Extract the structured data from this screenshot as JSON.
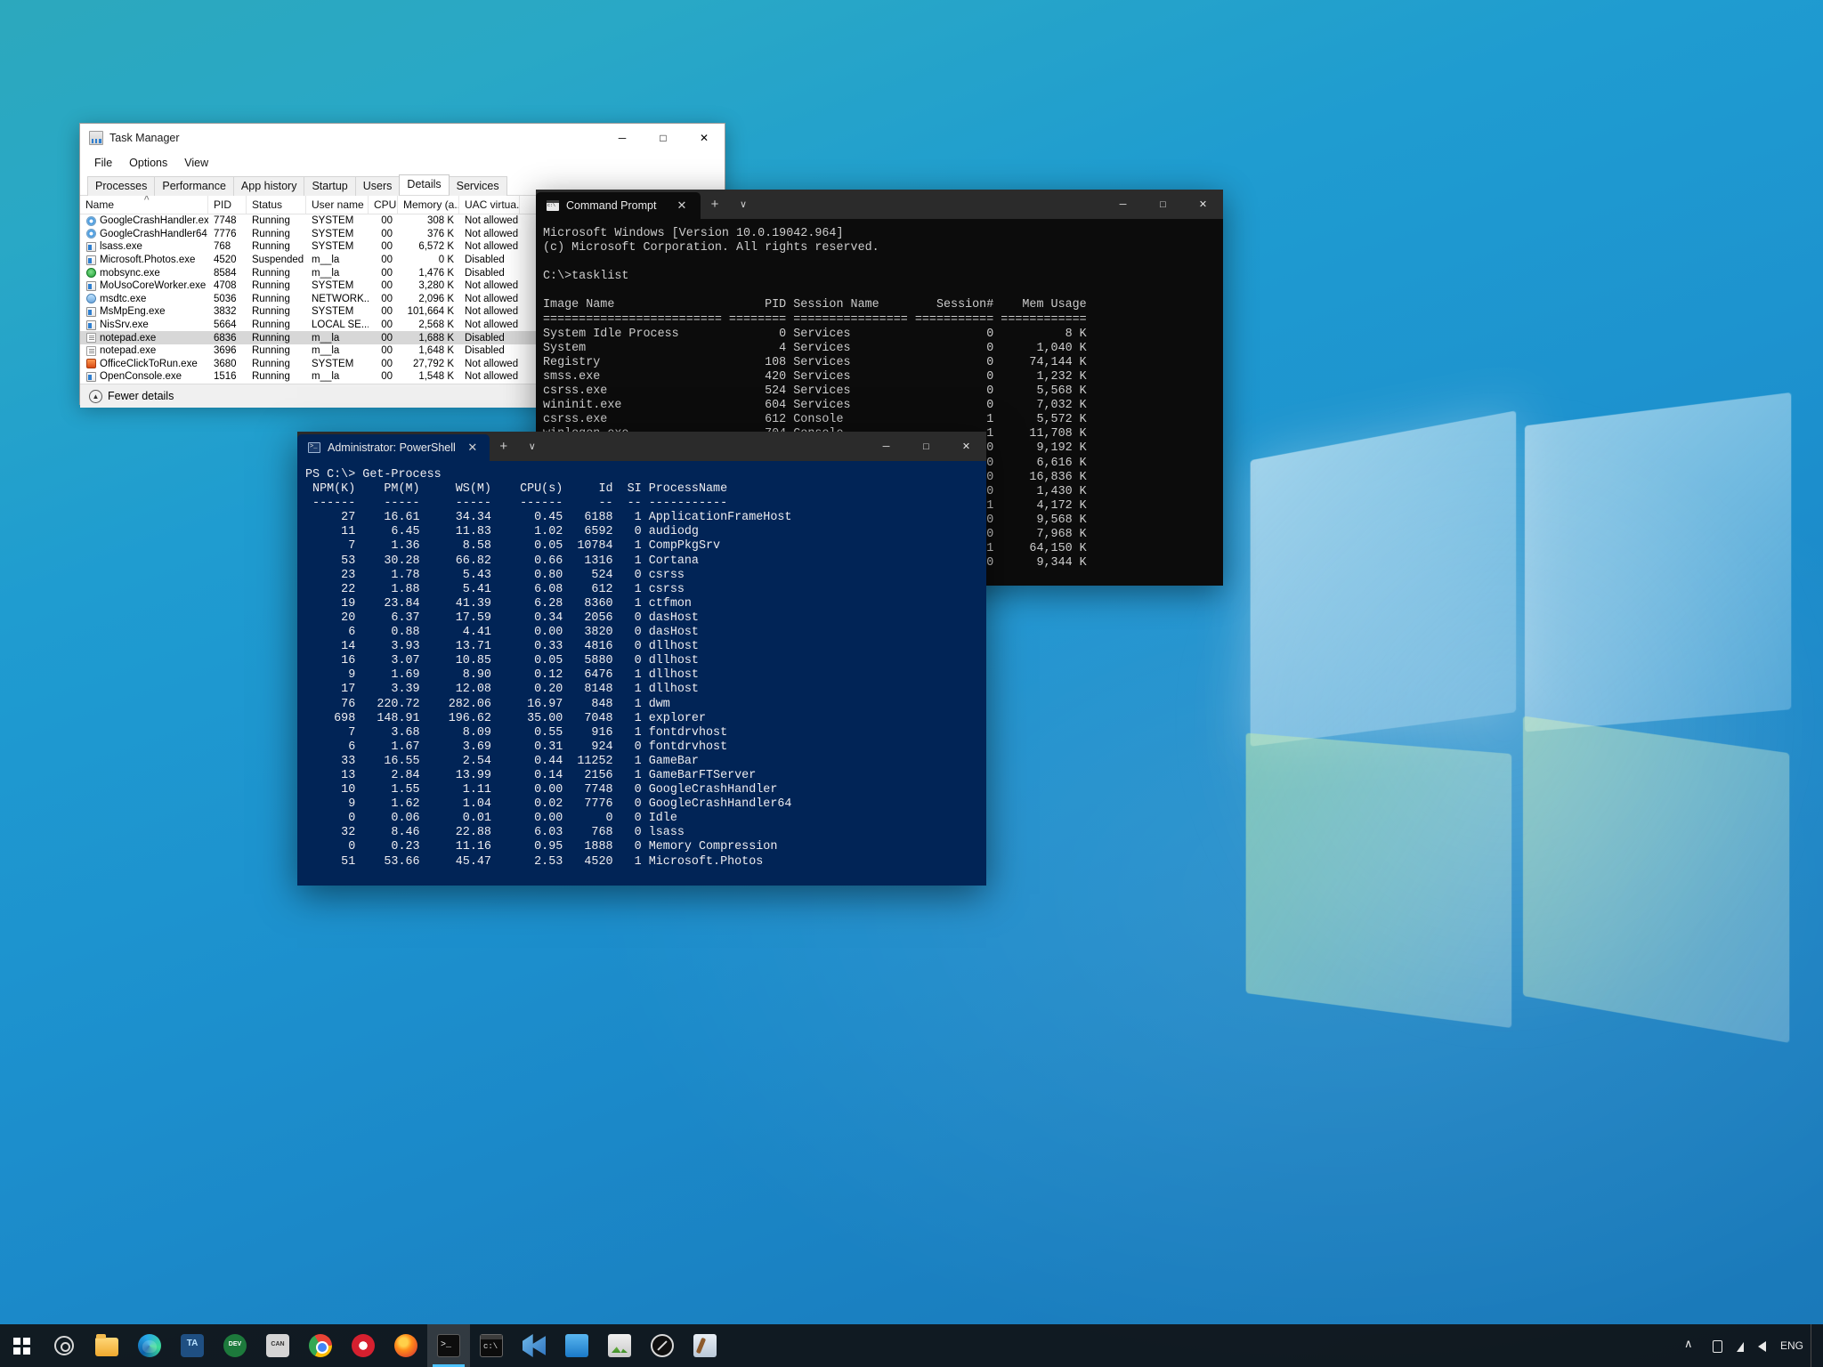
{
  "taskmanager": {
    "title": "Task Manager",
    "icon": "task-manager-icon",
    "window_buttons": {
      "minimize": "─",
      "maximize": "□",
      "close": "✕"
    },
    "menus": [
      "File",
      "Options",
      "View"
    ],
    "tabs": [
      {
        "label": "Processes",
        "active": false
      },
      {
        "label": "Performance",
        "active": false
      },
      {
        "label": "App history",
        "active": false
      },
      {
        "label": "Startup",
        "active": false
      },
      {
        "label": "Users",
        "active": false
      },
      {
        "label": "Details",
        "active": true
      },
      {
        "label": "Services",
        "active": false
      }
    ],
    "columns": [
      "Name",
      "PID",
      "Status",
      "User name",
      "CPU",
      "Memory (a...",
      "UAC virtua..."
    ],
    "sort_column": "Name",
    "rows": [
      {
        "name": "GoogleCrashHandler.exe",
        "icon": "chrome-icon",
        "pid": "7748",
        "status": "Running",
        "user": "SYSTEM",
        "cpu": "00",
        "memory": "308 K",
        "uac": "Not allowed",
        "selected": false
      },
      {
        "name": "GoogleCrashHandler64.exe",
        "icon": "chrome-icon",
        "pid": "7776",
        "status": "Running",
        "user": "SYSTEM",
        "cpu": "00",
        "memory": "376 K",
        "uac": "Not allowed",
        "selected": false
      },
      {
        "name": "lsass.exe",
        "icon": "document-icon",
        "pid": "768",
        "status": "Running",
        "user": "SYSTEM",
        "cpu": "00",
        "memory": "6,572 K",
        "uac": "Not allowed",
        "selected": false
      },
      {
        "name": "Microsoft.Photos.exe",
        "icon": "document-icon",
        "pid": "4520",
        "status": "Suspended",
        "user": "m__la",
        "cpu": "00",
        "memory": "0 K",
        "uac": "Disabled",
        "selected": false
      },
      {
        "name": "mobsync.exe",
        "icon": "green-circle-icon",
        "pid": "8584",
        "status": "Running",
        "user": "m__la",
        "cpu": "00",
        "memory": "1,476 K",
        "uac": "Disabled",
        "selected": false
      },
      {
        "name": "MoUsoCoreWorker.exe",
        "icon": "document-icon",
        "pid": "4708",
        "status": "Running",
        "user": "SYSTEM",
        "cpu": "00",
        "memory": "3,280 K",
        "uac": "Not allowed",
        "selected": false
      },
      {
        "name": "msdtc.exe",
        "icon": "blue-circle-icon",
        "pid": "5036",
        "status": "Running",
        "user": "NETWORK...",
        "cpu": "00",
        "memory": "2,096 K",
        "uac": "Not allowed",
        "selected": false
      },
      {
        "name": "MsMpEng.exe",
        "icon": "document-icon",
        "pid": "3832",
        "status": "Running",
        "user": "SYSTEM",
        "cpu": "00",
        "memory": "101,664 K",
        "uac": "Not allowed",
        "selected": false
      },
      {
        "name": "NisSrv.exe",
        "icon": "document-icon",
        "pid": "5664",
        "status": "Running",
        "user": "LOCAL SE...",
        "cpu": "00",
        "memory": "2,568 K",
        "uac": "Not allowed",
        "selected": false
      },
      {
        "name": "notepad.exe",
        "icon": "notepad-icon",
        "pid": "6836",
        "status": "Running",
        "user": "m__la",
        "cpu": "00",
        "memory": "1,688 K",
        "uac": "Disabled",
        "selected": true
      },
      {
        "name": "notepad.exe",
        "icon": "notepad-icon",
        "pid": "3696",
        "status": "Running",
        "user": "m__la",
        "cpu": "00",
        "memory": "1,648 K",
        "uac": "Disabled",
        "selected": false
      },
      {
        "name": "OfficeClickToRun.exe",
        "icon": "orange-icon",
        "pid": "3680",
        "status": "Running",
        "user": "SYSTEM",
        "cpu": "00",
        "memory": "27,792 K",
        "uac": "Not allowed",
        "selected": false
      },
      {
        "name": "OpenConsole.exe",
        "icon": "document-icon",
        "pid": "1516",
        "status": "Running",
        "user": "m__la",
        "cpu": "00",
        "memory": "1,548 K",
        "uac": "Not allowed",
        "selected": false
      }
    ],
    "footer": {
      "label": "Fewer details",
      "icon": "chevron-up-circle-icon"
    }
  },
  "cmd": {
    "tab_title": "Command Prompt",
    "tab_icon": "cmd-icon",
    "close_tab": "✕",
    "new_tab": "+",
    "tab_menu": "∨",
    "window_buttons": {
      "minimize": "─",
      "maximize": "□",
      "close": "✕"
    },
    "content": "Microsoft Windows [Version 10.0.19042.964]\n(c) Microsoft Corporation. All rights reserved.\n\nC:\\>tasklist\n\nImage Name                     PID Session Name        Session#    Mem Usage\n========================= ======== ================ =========== ============\nSystem Idle Process              0 Services                   0          8 K\nSystem                           4 Services                   0      1,040 K\nRegistry                       108 Services                   0     74,144 K\nsmss.exe                       420 Services                   0      1,232 K\ncsrss.exe                      524 Services                   0      5,568 K\nwininit.exe                    604 Services                   0      7,032 K\ncsrss.exe                      612 Console                    1      5,572 K\nwinlogon.exe                   704 Console                    1     11,708 K\nservices.exe                   752 Services                   0      9,192 K\nlsass.exe                      768 Services                   0      6,616 K\nsvchost.exe                    908 Services                   0     16,836 K\nfontdrvhost.exe                924 Services                   0      1,430 K\nfontdrvhost.exe                916 Console                    1      4,172 K\nsvchost.exe                    468 Services                   0      9,568 K\nsvchost.exe                   1052 Services                   0      7,968 K\ndwm.exe                        848 Console                    1     64,150 K\nsvchost.exe                   1180 Services                   0      9,344 K"
  },
  "powershell": {
    "tab_title": "Administrator: PowerShell",
    "tab_icon": "powershell-icon",
    "close_tab": "✕",
    "new_tab": "+",
    "tab_menu": "∨",
    "window_buttons": {
      "minimize": "─",
      "maximize": "□",
      "close": "✕"
    },
    "prompt": "PS C:\\> Get-Process",
    "header": " NPM(K)    PM(M)     WS(M)    CPU(s)     Id  SI ProcessName",
    "separator": " ------    -----     -----    ------     --  -- -----------",
    "content": "     27    16.61     34.34      0.45   6188   1 ApplicationFrameHost\n     11     6.45     11.83      1.02   6592   0 audiodg\n      7     1.36      8.58      0.05  10784   1 CompPkgSrv\n     53    30.28     66.82      0.66   1316   1 Cortana\n     23     1.78      5.43      0.80    524   0 csrss\n     22     1.88      5.41      6.08    612   1 csrss\n     19    23.84     41.39      6.28   8360   1 ctfmon\n     20     6.37     17.59      0.34   2056   0 dasHost\n      6     0.88      4.41      0.00   3820   0 dasHost\n     14     3.93     13.71      0.33   4816   0 dllhost\n     16     3.07     10.85      0.05   5880   0 dllhost\n      9     1.69      8.90      0.12   6476   1 dllhost\n     17     3.39     12.08      0.20   8148   1 dllhost\n     76   220.72    282.06     16.97    848   1 dwm\n    698   148.91    196.62     35.00   7048   1 explorer\n      7     3.68      8.09      0.55    916   1 fontdrvhost\n      6     1.67      3.69      0.31    924   0 fontdrvhost\n     33    16.55      2.54      0.44  11252   1 GameBar\n     13     2.84     13.99      0.14   2156   1 GameBarFTServer\n     10     1.55      1.11      0.00   7748   0 GoogleCrashHandler\n      9     1.62      1.04      0.02   7776   0 GoogleCrashHandler64\n      0     0.06      0.01      0.00      0   0 Idle\n     32     8.46     22.88      6.03    768   0 lsass\n      0     0.23     11.16      0.95   1888   0 Memory Compression\n     51    53.66     45.47      2.53   4520   1 Microsoft.Photos"
  },
  "taskbar": {
    "start": {
      "name": "start-button"
    },
    "items": [
      {
        "name": "settings",
        "icon": "settings-gear-icon",
        "active": false
      },
      {
        "name": "file-explorer",
        "icon": "folder-icon",
        "active": false
      },
      {
        "name": "microsoft-edge",
        "icon": "edge-icon",
        "active": false
      },
      {
        "name": "ta-app",
        "icon": "ta-icon",
        "active": false
      },
      {
        "name": "dev-app",
        "icon": "dev-icon",
        "active": false
      },
      {
        "name": "can-app",
        "icon": "can-icon",
        "active": false
      },
      {
        "name": "google-chrome",
        "icon": "chrome-icon",
        "active": false
      },
      {
        "name": "opera",
        "icon": "opera-icon",
        "active": false
      },
      {
        "name": "firefox",
        "icon": "firefox-icon",
        "active": false
      },
      {
        "name": "windows-terminal",
        "icon": "terminal-icon",
        "active": true
      },
      {
        "name": "command-prompt",
        "icon": "cmd-icon",
        "active": false
      },
      {
        "name": "visual-studio",
        "icon": "visual-studio-icon",
        "active": false
      },
      {
        "name": "blue-app",
        "icon": "blue-app-icon",
        "active": false
      },
      {
        "name": "photos",
        "icon": "photos-icon",
        "active": false
      },
      {
        "name": "ghost-app",
        "icon": "ghost-icon",
        "active": false
      },
      {
        "name": "paint",
        "icon": "paint-icon",
        "active": false
      }
    ],
    "tray": {
      "show_hidden": "show-hidden-icons-chevron",
      "usb": "usb-safely-remove-icon",
      "network": "network-icon",
      "volume": "volume-icon",
      "language": "ENG"
    }
  }
}
